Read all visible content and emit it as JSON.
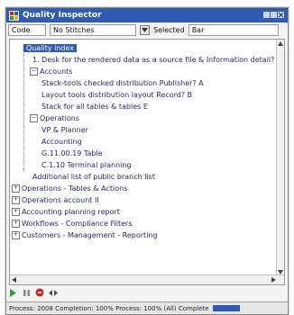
{
  "window": {
    "title": "Quality Inspector",
    "title_color": "#2f5bb0"
  },
  "toolbar": {
    "field1_value": "Code",
    "field2_value": "No Stitches",
    "label": "Selected",
    "field3_value": "Bar"
  },
  "tree": {
    "selected_label": "Quality index",
    "rows": [
      {
        "text": "Quality index",
        "level": 1,
        "toggle": "",
        "selected": true
      },
      {
        "text": "1. Desk for the rendered data as a source file & Information detail?",
        "level": 2,
        "toggle": ""
      },
      {
        "text": "Accounts",
        "level": 2,
        "toggle": "-"
      },
      {
        "text": "Stack-tools checked distribution Publisher? A",
        "level": 3,
        "toggle": ""
      },
      {
        "text": "Layout tools distribution layout Record? B",
        "level": 3,
        "toggle": ""
      },
      {
        "text": "Stack for all tables & tables E",
        "level": 3,
        "toggle": ""
      },
      {
        "text": "Operations",
        "level": 2,
        "toggle": "-"
      },
      {
        "text": "VP & Planner",
        "level": 3,
        "toggle": ""
      },
      {
        "text": "Accounting",
        "level": 3,
        "toggle": ""
      },
      {
        "text": "G.11.00.19 Table",
        "level": 3,
        "toggle": ""
      },
      {
        "text": "C.1.10 Terminal planning",
        "level": 3,
        "toggle": ""
      },
      {
        "text": "Additional list of public branch list",
        "level": 2,
        "toggle": ""
      },
      {
        "text": "Operations - Tables & Actions",
        "level": 0,
        "toggle": "+"
      },
      {
        "text": "Operations account II",
        "level": 0,
        "toggle": "+"
      },
      {
        "text": "Accounting planning report",
        "level": 0,
        "toggle": "+"
      },
      {
        "text": "Workflows - Compliance Filters",
        "level": 0,
        "toggle": "+"
      },
      {
        "text": "Customers - Management - Reporting",
        "level": 0,
        "toggle": "+"
      }
    ]
  },
  "status": {
    "text": "Process: 2008 Completion: 100% Process: 100% (All) Complete"
  },
  "icons": {
    "app": "app-icon",
    "close": "close-icon",
    "play": "play-icon",
    "pause": "pause-icon",
    "stop": "stop-icon",
    "record": "record-icon"
  },
  "colors": {
    "selection": "#2f5bb0",
    "stop_red": "#d02020",
    "play_green": "#2aa02a"
  }
}
